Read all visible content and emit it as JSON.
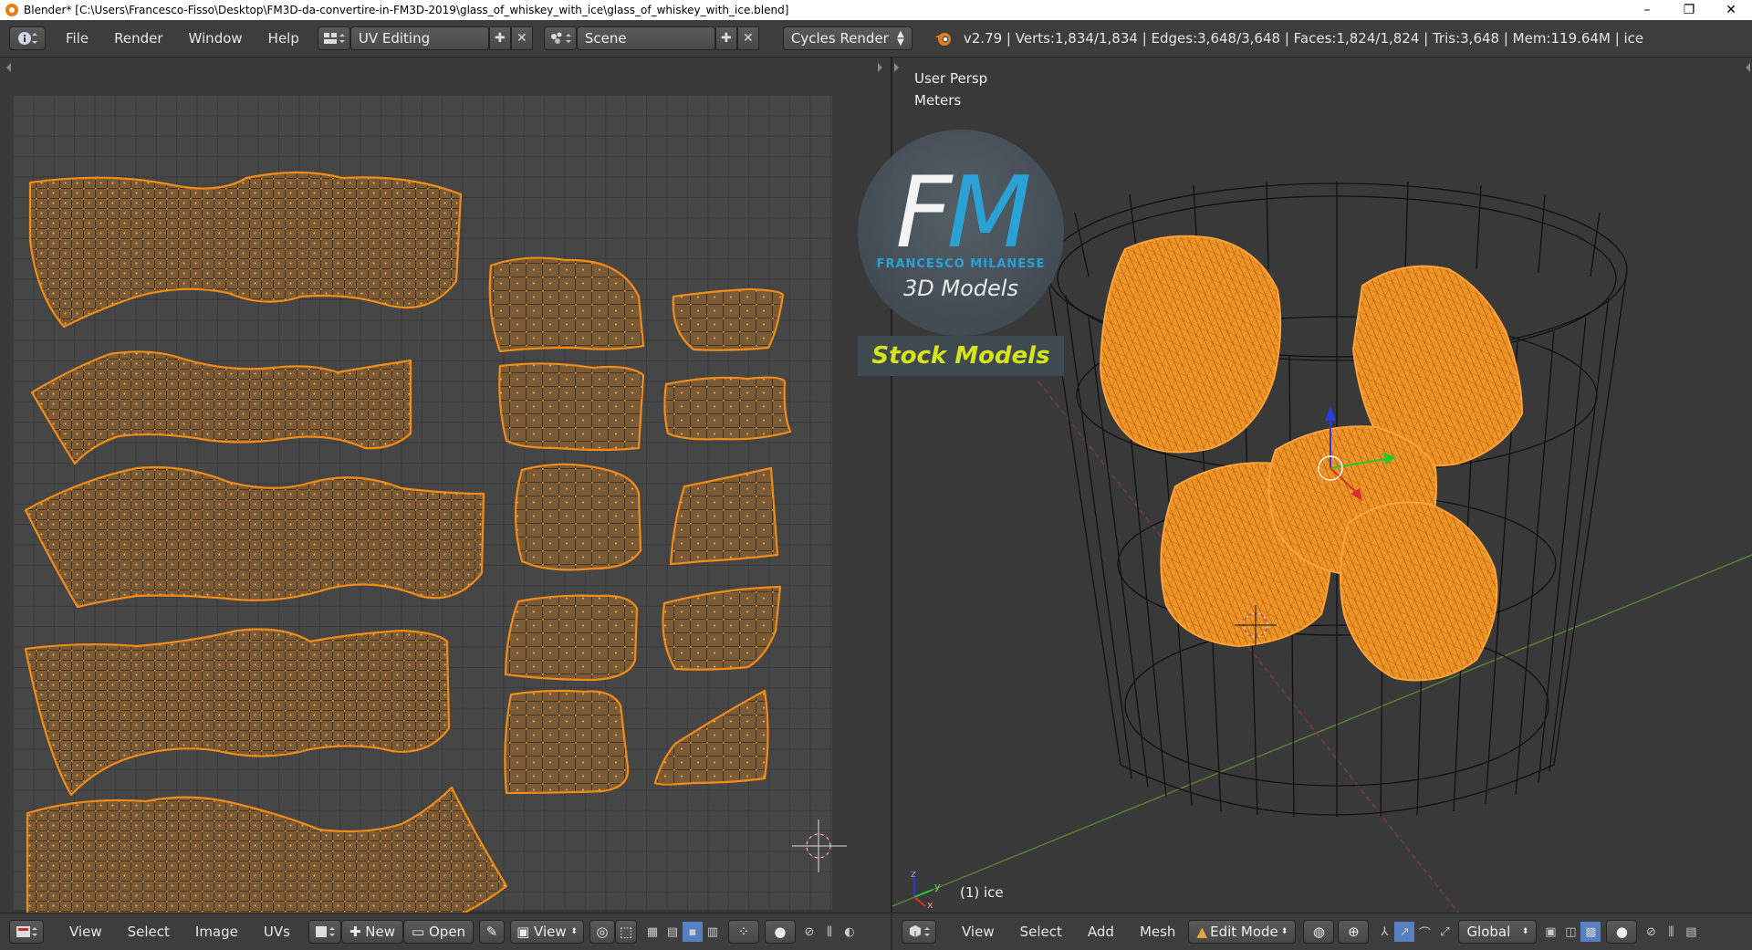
{
  "window": {
    "title": "Blender* [C:\\Users\\Francesco-Fisso\\Desktop\\FM3D-da-convertire-in-FM3D-2019\\glass_of_whiskey_with_ice\\glass_of_whiskey_with_ice.blend]",
    "minimize": "–",
    "restore": "❐",
    "close": "✕"
  },
  "info_header": {
    "menus": [
      "File",
      "Render",
      "Window",
      "Help"
    ],
    "screen_layout": "UV Editing",
    "scene": "Scene",
    "render_engine": "Cycles Render",
    "stats": "v2.79 | Verts:1,834/1,834 | Edges:3,648/3,648 | Faces:1,824/1,824 | Tris:3,648 | Mem:119.64M | ice"
  },
  "uv_footer": {
    "menus": [
      "View",
      "Select",
      "Image",
      "UVs"
    ],
    "new_label": "New",
    "open_label": "Open",
    "view_label": "View"
  },
  "view3d": {
    "view_name": "User Persp",
    "units": "Meters",
    "object_label": "(1) ice",
    "axis_x": "x",
    "axis_y": "y",
    "axis_z": "z"
  },
  "view3d_footer": {
    "menus": [
      "View",
      "Select",
      "Add",
      "Mesh"
    ],
    "mode": "Edit Mode",
    "orientation": "Global"
  },
  "watermark": {
    "fm_f": "F",
    "fm_m": "M",
    "name": "FRANCESCO MILANESE",
    "sub": "3D Models",
    "stock": "Stock Models"
  },
  "colors": {
    "selection_orange": "#f08c17",
    "uv_fill": "#7a5a36",
    "logo_blue": "#2aa8df",
    "stock_yellow": "#d7e41c"
  }
}
